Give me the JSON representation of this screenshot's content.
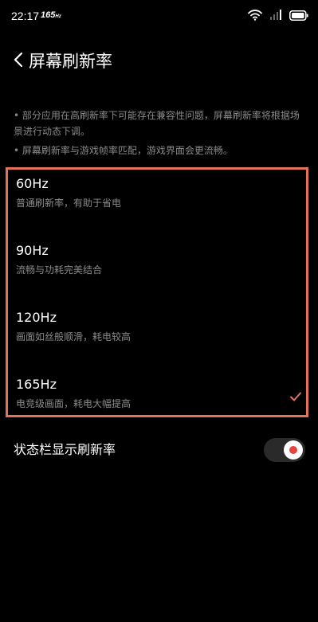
{
  "status_bar": {
    "time": "22:17",
    "refresh_rate_main": "165",
    "refresh_rate_unit": "Hz",
    "icons": [
      "wifi-icon",
      "signal-icon",
      "battery-icon"
    ]
  },
  "header": {
    "back_icon": "chevron-left-icon",
    "title": "屏幕刷新率"
  },
  "notes": [
    "• 部分应用在高刷新率下可能存在兼容性问题，屏幕刷新率将根据场景进行动态下调。",
    "• 屏幕刷新率与游戏帧率匹配，游戏界面会更流畅。"
  ],
  "options": [
    {
      "title": "60Hz",
      "description": "普通刷新率，有助于省电",
      "selected": false
    },
    {
      "title": "90Hz",
      "description": "流畅与功耗完美结合",
      "selected": false
    },
    {
      "title": "120Hz",
      "description": "画面如丝般顺滑，耗电较高",
      "selected": false
    },
    {
      "title": "165Hz",
      "description": "电竞级画面，耗电大幅提高",
      "selected": true
    }
  ],
  "status_bar_toggle": {
    "label": "状态栏显示刷新率",
    "enabled": true
  },
  "colors": {
    "background": "#000000",
    "accent": "#e4715a",
    "toggle_dot": "#e8413e",
    "secondary_text": "#8a8a8a"
  }
}
